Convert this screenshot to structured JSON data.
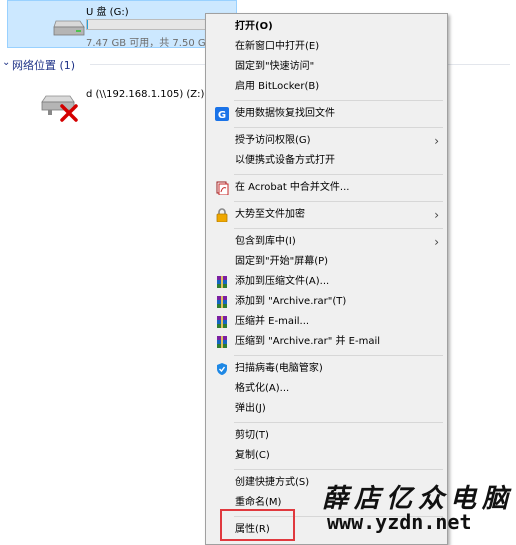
{
  "drive": {
    "name": "U 盘 (G:)",
    "free_text": "7.47 GB 可用，共 7.50 GB",
    "used_fraction": 0.004
  },
  "network_group": {
    "title": "网络位置 (1)",
    "item_name": "d (\\\\192.168.1.105) (Z:)"
  },
  "menu": {
    "open": "打开(O)",
    "open_new_window": "在新窗口中打开(E)",
    "pin_quick_access": "固定到\"快速访问\"",
    "bitlocker": "启用 BitLocker(B)",
    "data_recovery": "使用数据恢复找回文件",
    "give_access": "授予访问权限(G)",
    "open_portable": "以便携式设备方式打开",
    "acrobat_merge": "在 Acrobat 中合并文件...",
    "encrypt": "大势至文件加密",
    "include_library": "包含到库中(I)",
    "pin_start": "固定到\"开始\"屏幕(P)",
    "add_archive": "添加到压缩文件(A)...",
    "add_archive_rar": "添加到 \"Archive.rar\"(T)",
    "compress_email": "压缩并 E-mail...",
    "compress_rar_email": "压缩到 \"Archive.rar\" 并 E-mail",
    "scan_virus": "扫描病毒(电脑管家)",
    "format": "格式化(A)...",
    "eject": "弹出(J)",
    "cut": "剪切(T)",
    "copy": "复制(C)",
    "create_shortcut": "创建快捷方式(S)",
    "rename": "重命名(M)",
    "properties": "属性(R)"
  },
  "watermark": {
    "cn": "薛店亿众电脑",
    "url": "www.yzdn.net"
  },
  "colors": {
    "selection_bg": "#cce8ff",
    "group_text": "#1e3287",
    "highlight_box": "#e0393e"
  }
}
